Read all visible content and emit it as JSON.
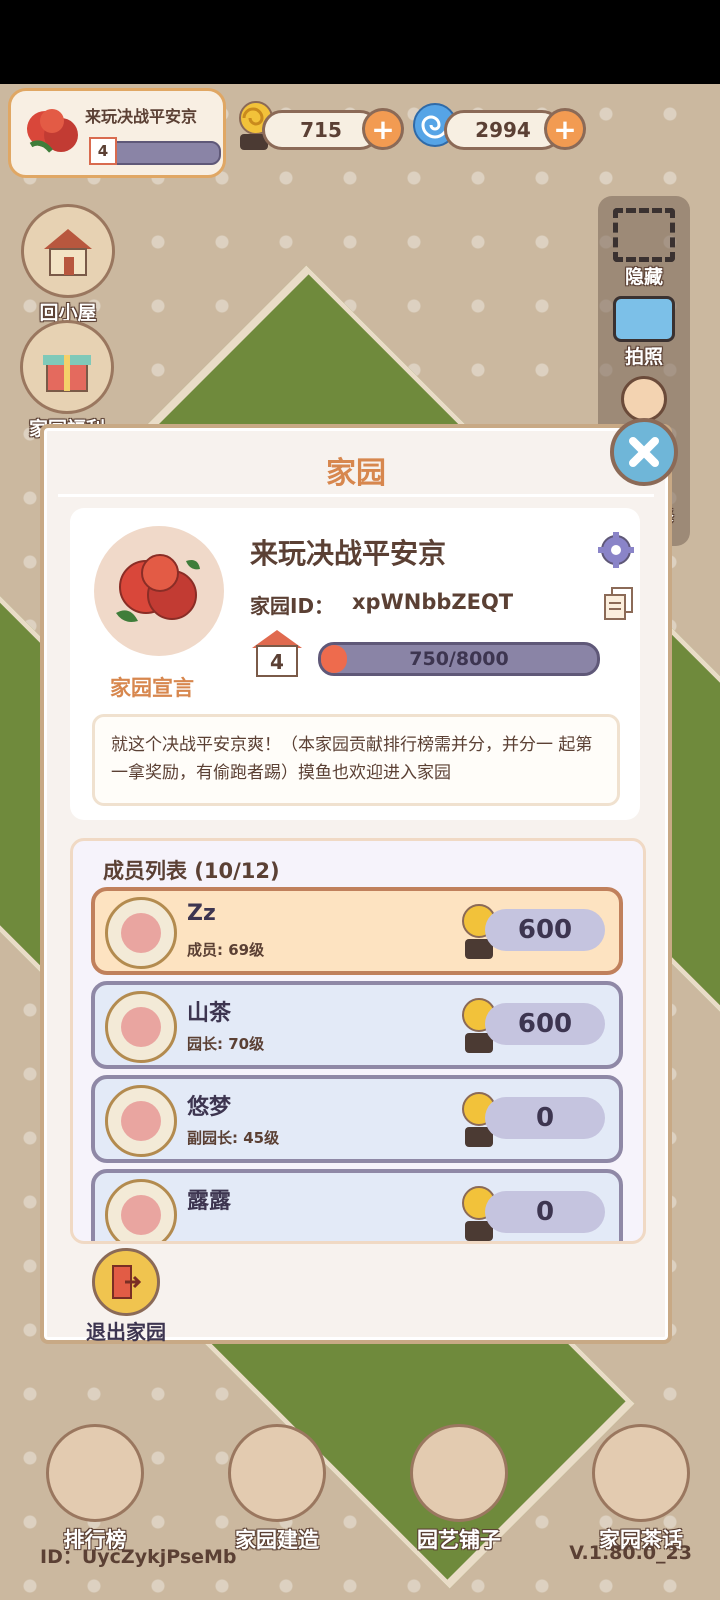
{
  "game": {
    "family": {
      "name": "来玩决战平安京",
      "level": "4"
    },
    "currency": {
      "snail": "715",
      "swirl": "2994"
    },
    "side_left": [
      {
        "label": "回小屋"
      },
      {
        "label": "家园福利"
      }
    ],
    "side_right": [
      {
        "label": "隐藏"
      },
      {
        "label": "拍照"
      },
      {
        "label": "修"
      }
    ],
    "bottom_nav": [
      {
        "label": "排行榜"
      },
      {
        "label": "家园建造"
      },
      {
        "label": "园艺铺子"
      },
      {
        "label": "家园茶话"
      }
    ],
    "footer": {
      "id": "ID：UycZykjPseMb",
      "version": "V.1.80.0_23"
    }
  },
  "dialog": {
    "title": "家园",
    "home": {
      "name": "来玩决战平安京",
      "id_label": "家园ID：",
      "id_value": "xpWNbbZEQT",
      "level": "4",
      "exp_text": "750/8000",
      "exp_fraction": 0.094,
      "declaration_label": "家园宣言",
      "declaration": "就这个决战平安京爽！（本家园贡献排行榜需并分，并分一 起第一拿奖励，有偷跑者踢）摸鱼也欢迎进入家园"
    },
    "members": {
      "title": "成员列表 (10/12)",
      "list": [
        {
          "name": "Zz",
          "role": "成员: 69级",
          "score": "600",
          "avatar": "tulip-avatar"
        },
        {
          "name": "山茶",
          "role": "园长: 70级",
          "score": "600",
          "avatar": "black-cat-avatar"
        },
        {
          "name": "悠梦",
          "role": "副园长: 45级",
          "score": "0",
          "avatar": "gray-cat-avatar"
        },
        {
          "name": "露露",
          "role": "",
          "score": "0",
          "avatar": "strawberry-avatar"
        }
      ]
    },
    "exit_label": "退出家园"
  },
  "colors": {
    "accent": "#d7874e",
    "exp_fill": "#ee6b4d",
    "lawn": "#6f8a3c"
  }
}
